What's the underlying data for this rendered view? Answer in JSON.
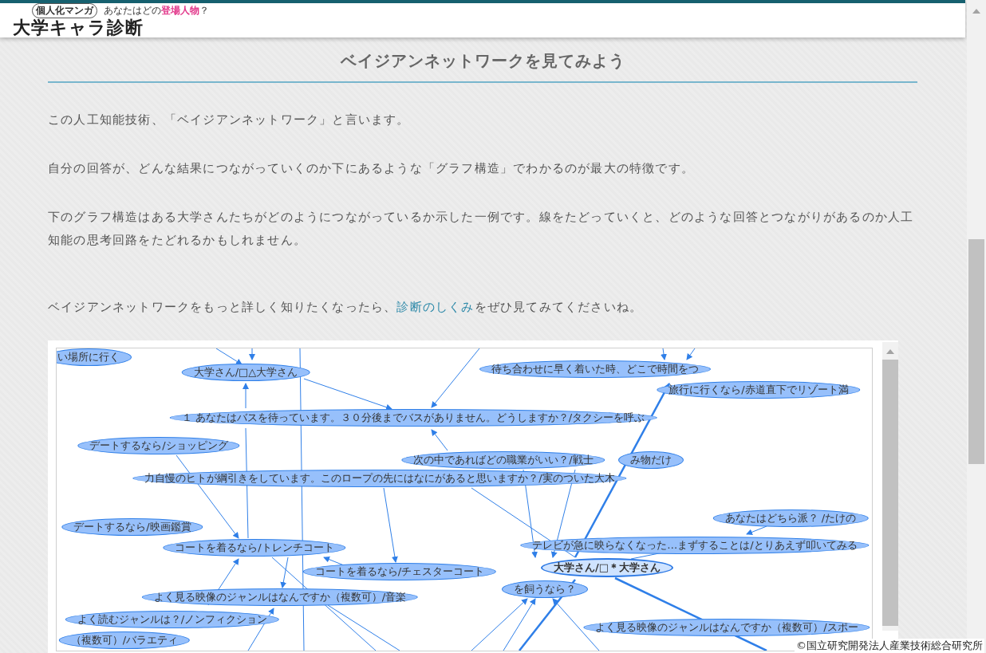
{
  "header": {
    "logo_bubble": "個人化マンガ",
    "logo_tagline": "あなたはどの**登場人物**？",
    "logo_title": "大学キャラ診断"
  },
  "section": {
    "heading": "ベイジアンネットワークを見てみよう",
    "paragraphs": [
      "この人工知能技術、「ベイジアンネットワーク」と言います。",
      "自分の回答が、どんな結果につながっていくのか下にあるような「グラフ構造」でわかるのが最大の特徴です。",
      "下のグラフ構造はある大学さんたちがどのようにつながっているか示した一例です。線をたどっていくと、どのような回答とつながりがあるのか人工知能の思考回路をたどれるかもしれません。"
    ],
    "link_sentence": {
      "before": "ベイジアンネットワークをもっと詳しく知りたくなったら、",
      "link": "診断のしくみ",
      "after": "をぜひ見てみてくださいね。"
    }
  },
  "graph": {
    "nodes": [
      {
        "label": "い場所に行く",
        "highlighted": false
      },
      {
        "label": "大学さん/□△大学さん",
        "highlighted": false
      },
      {
        "label": "待ち合わせに早く着いた時、どこで時間をつ",
        "highlighted": false
      },
      {
        "label": "旅行に行くなら/赤道直下でリゾート満",
        "highlighted": false
      },
      {
        "label": "１ あなたはバスを待っています。３０分後までバスがありません。どうしますか？/タクシーを呼ぶ",
        "highlighted": false
      },
      {
        "label": "デートするなら/ショッピング",
        "highlighted": false
      },
      {
        "label": "次の中であればどの職業がいい？/戦士",
        "highlighted": false
      },
      {
        "label": "み物だけ",
        "highlighted": false
      },
      {
        "label": "力自慢のヒトが綱引きをしています。このロープの先にはなにがあると思いますか？/実のついた大木",
        "highlighted": false
      },
      {
        "label": "あなたはどちら派？ /たけの",
        "highlighted": false
      },
      {
        "label": "デートするなら/映画鑑賞",
        "highlighted": false
      },
      {
        "label": "コートを着るなら/トレンチコート",
        "highlighted": false
      },
      {
        "label": "テレビが急に映らなくなった…まずすることは/とりあえず叩いてみる",
        "highlighted": false
      },
      {
        "label": "コートを着るなら/チェスターコート",
        "highlighted": false
      },
      {
        "label": "大学さん/□＊大学さん",
        "highlighted": true
      },
      {
        "label": "を飼うなら？",
        "highlighted": false
      },
      {
        "label": "よく見る映像のジャンルはなんですか（複数可）/音楽",
        "highlighted": false
      },
      {
        "label": "よく読むジャンルは？/ノンフィクション",
        "highlighted": false
      },
      {
        "label": "よく見る映像のジャンルはなんですか（複数可）/スポー",
        "highlighted": false
      },
      {
        "label": "（複数可）/バラエティ",
        "highlighted": false
      }
    ]
  },
  "copyright": "©国立研究開発法人産業技術総合研究所"
}
